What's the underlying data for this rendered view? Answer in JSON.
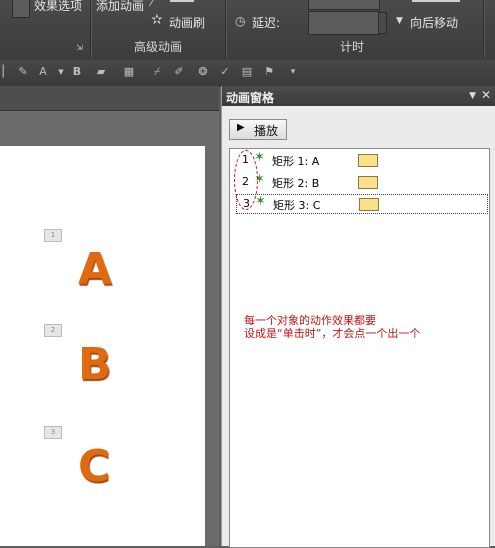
{
  "ribbon": {
    "effect_options_label": "效果选项",
    "add_animation_label": "添加动画",
    "animation_painter_label": "动画刷",
    "advanced_group_label": "高级动画",
    "delay_label": "延迟:",
    "move_later_label": "向后移动",
    "timing_group_label": "计时"
  },
  "slide": {
    "letters": [
      "A",
      "B",
      "C"
    ],
    "tags": [
      "1",
      "2",
      "3"
    ]
  },
  "pane": {
    "title": "动画窗格",
    "play_label": "播放",
    "items": [
      {
        "num": "1",
        "label": "矩形 1: A"
      },
      {
        "num": "2",
        "label": "矩形 2: B"
      },
      {
        "num": "3",
        "label": "矩形 3: C"
      }
    ],
    "note_line1": "每一个对象的动作效果都要",
    "note_line2": "设成是“单击时”，才会点一个出一个"
  },
  "colors": {
    "letter": "#e06a10",
    "annotation": "#c01515",
    "timeline_bar": "#fbe08a"
  }
}
